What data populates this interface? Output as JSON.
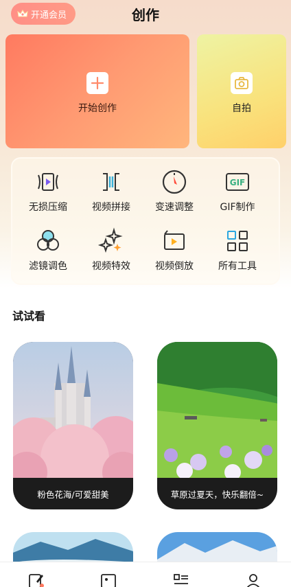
{
  "header": {
    "vip_label": "开通会员",
    "title": "创作"
  },
  "quick_actions": {
    "start_create": "开始创作",
    "selfie": "自拍"
  },
  "tools": [
    {
      "label": "无损压缩",
      "icon": "compress-icon"
    },
    {
      "label": "视频拼接",
      "icon": "splice-icon"
    },
    {
      "label": "变速调整",
      "icon": "speed-dial-icon"
    },
    {
      "label": "GIF制作",
      "icon": "gif-icon"
    },
    {
      "label": "滤镜调色",
      "icon": "filter-circles-icon"
    },
    {
      "label": "视频特效",
      "icon": "sparkle-stars-icon"
    },
    {
      "label": "视频倒放",
      "icon": "reverse-play-icon"
    },
    {
      "label": "所有工具",
      "icon": "grid-icon"
    }
  ],
  "gif_badge": "GIF",
  "section": {
    "title": "试试看"
  },
  "feed": [
    {
      "caption": "粉色花海/可爱甜美"
    },
    {
      "caption": "草原过夏天，快乐翻倍~"
    }
  ],
  "colors": {
    "accent": "#ff7a60",
    "vip": "#ff8f86",
    "selfie_card": "#f9e27c"
  }
}
